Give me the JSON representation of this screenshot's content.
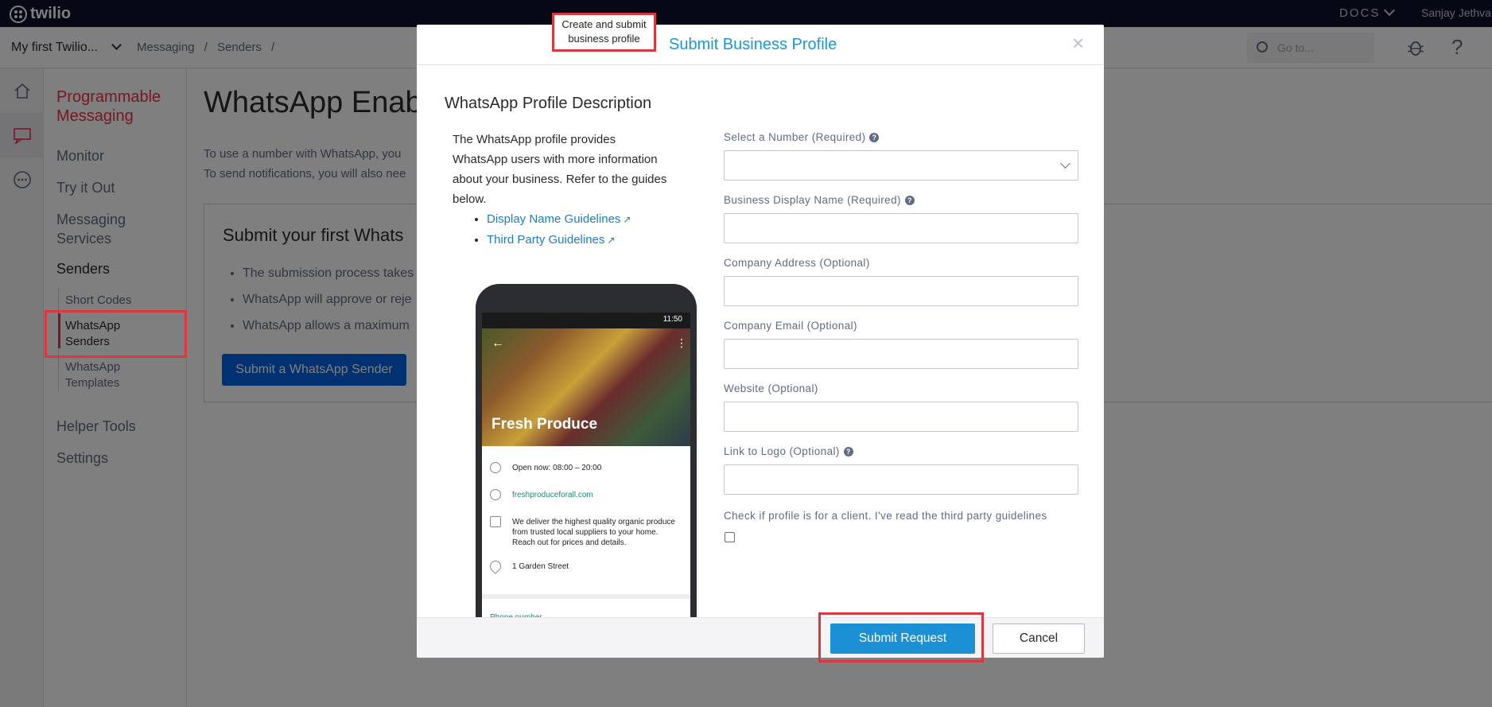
{
  "brand": {
    "logo_text": "twilio"
  },
  "topbar": {
    "docs_label": "DOCS",
    "user_name": "Sanjay Jethva"
  },
  "subbar": {
    "project": "My first Twilio...",
    "breadcrumb": [
      "Messaging",
      "/",
      "Senders",
      "/"
    ],
    "goto_placeholder": "Go to..."
  },
  "nav": {
    "title": "Programmable Messaging",
    "items": [
      {
        "label": "Monitor"
      },
      {
        "label": "Try it Out"
      },
      {
        "label": "Messaging Services"
      },
      {
        "label": "Senders"
      },
      {
        "label": "Helper Tools"
      },
      {
        "label": "Settings"
      }
    ],
    "sub_items": [
      {
        "label": "Short Codes"
      },
      {
        "label": "WhatsApp Senders",
        "active": true
      },
      {
        "label": "WhatsApp Templates"
      }
    ]
  },
  "main": {
    "title": "WhatsApp Enab",
    "intro_line1": "To use a number with WhatsApp, you",
    "intro_line2": "To send notifications, you will also nee",
    "card_title": "Submit your first Whats",
    "card_bullets": [
      "The submission process takes",
      "WhatsApp will approve or reje",
      "WhatsApp allows a maximum"
    ],
    "card_button": "Submit a WhatsApp Sender"
  },
  "modal": {
    "title": "Submit Business Profile",
    "close_icon": "×",
    "section_title": "WhatsApp Profile Description",
    "description": "The WhatsApp profile provides WhatsApp users with more information about your business. Refer to the guides below.",
    "guides": [
      {
        "label": "Display Name Guidelines"
      },
      {
        "label": "Third Party Guidelines"
      }
    ],
    "phone": {
      "time": "11:50",
      "hero_title": "Fresh Produce",
      "hours": "Open now: 08:00 – 20:00",
      "website": "freshproduceforall.com",
      "about": "We deliver the highest quality organic produce from trusted local suppliers to your home. Reach out for prices and details.",
      "address": "1 Garden Street",
      "phone_label": "Phone number"
    },
    "form": {
      "number_label": "Select a Number (Required)",
      "number_value": "",
      "display_name_label": "Business Display Name (Required)",
      "display_name_value": "",
      "address_label": "Company Address (Optional)",
      "address_value": "",
      "email_label": "Company Email (Optional)",
      "email_value": "",
      "website_label": "Website (Optional)",
      "website_value": "",
      "logo_label": "Link to Logo (Optional)",
      "logo_value": "",
      "client_label": "Check if profile is for a client. I've read the third party guidelines",
      "client_checked": false
    },
    "submit_label": "Submit Request",
    "cancel_label": "Cancel"
  },
  "annotation": {
    "callout_text": "Create and submit business profile"
  },
  "colors": {
    "accent_red": "#f22f46",
    "link_blue": "#1b7dc4",
    "submit_blue": "#1b90d5",
    "topbar_navy": "#0d122b"
  }
}
